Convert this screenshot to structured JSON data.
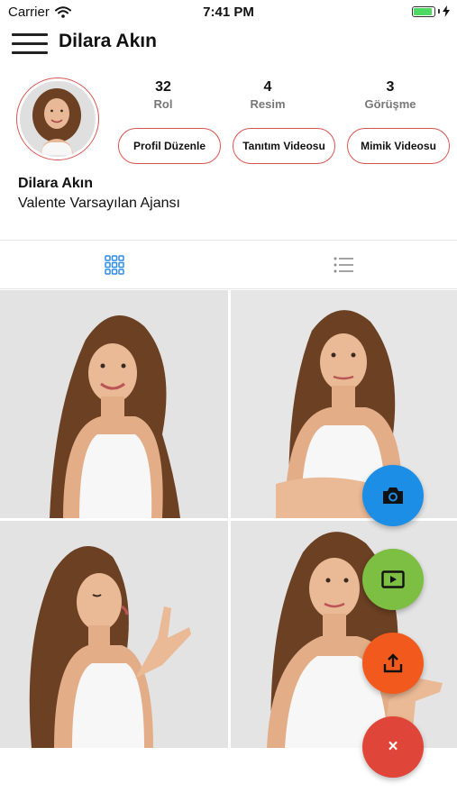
{
  "status_bar": {
    "carrier": "Carrier",
    "time": "7:41 PM"
  },
  "header": {
    "title": "Dilara Akın"
  },
  "stats": [
    {
      "value": "32",
      "label": "Rol"
    },
    {
      "value": "4",
      "label": "Resim"
    },
    {
      "value": "3",
      "label": "Görüşme"
    }
  ],
  "buttons": {
    "edit_profile": "Profil Düzenle",
    "intro_video": "Tanıtım Videosu",
    "mimic_video": "Mimik Videosu"
  },
  "profile": {
    "name": "Dilara Akın",
    "agency": "Valente Varsayılan Ajansı"
  },
  "tabs": [
    {
      "icon": "grid-icon",
      "active": true
    },
    {
      "icon": "list-icon",
      "active": false
    }
  ],
  "photos": [
    {
      "subject": "photo-smiling"
    },
    {
      "subject": "photo-arms-crossed"
    },
    {
      "subject": "photo-finger-gun"
    },
    {
      "subject": "photo-pondering"
    }
  ],
  "fab": {
    "camera": {
      "icon": "camera-icon",
      "color": "#1c8ee6"
    },
    "video": {
      "icon": "play-icon",
      "color": "#7cbf43"
    },
    "upload": {
      "icon": "upload-icon",
      "color": "#f25a1d"
    },
    "close": {
      "icon": "close-icon",
      "label": "×",
      "color": "#e0453a"
    }
  },
  "colors": {
    "accent": "#d9544f",
    "tab_active": "#2d8ce6",
    "tab_inactive": "#8e8e8e"
  }
}
